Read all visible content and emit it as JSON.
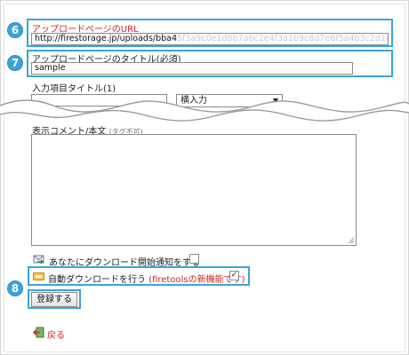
{
  "markers": {
    "m6": "6",
    "m7": "7",
    "m8": "8"
  },
  "upload_url": {
    "label": "アップロードページのURL",
    "value_visible": "http://firestorage.jp/uploads/bba4",
    "value_blurred": "5f3a9c0e1d8b7a6c2e4f3a1b9c8d7e6f5a4b3c2d1e0f9a8b7c6d5"
  },
  "page_title": {
    "label": "アップロードページのタイトル(必須)",
    "value": "sample"
  },
  "input_item": {
    "label": "入力項目タイトル(1)",
    "value": "",
    "type_selected": "横入力"
  },
  "comment": {
    "label": "表示コメント/本文",
    "note": "(タグ不可)",
    "value": ""
  },
  "notify_download": {
    "label": "あなたにダウンロード開始通知をする",
    "checked": false
  },
  "auto_download": {
    "label": "自動ダウンロードを行う",
    "note": "(firetoolsの新機能です)",
    "checked": true,
    "check_mark": "✓"
  },
  "register_button": {
    "label": "登録する"
  },
  "back_link": {
    "label": "戻る"
  },
  "colors": {
    "highlight": "#3aa3df",
    "accent_red": "#d62222"
  },
  "icons": {
    "notify": "mail-arrow-icon",
    "auto": "key-tag-icon",
    "back": "back-arrow-icon",
    "select_arrow": "chevron-down-icon",
    "resize": "resize-grip-icon"
  }
}
